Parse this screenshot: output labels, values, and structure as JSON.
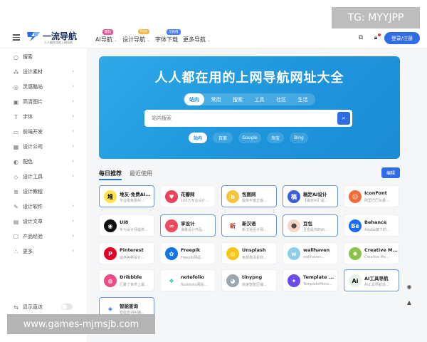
{
  "watermark_top": "TG: MYYJPP",
  "watermark_bottom": "www.games-mjmsjb.com",
  "logo": {
    "title": "一流导航",
    "subtitle": "人人都在用的上网导航"
  },
  "nav": [
    {
      "label": "AI导航",
      "badge": "最热",
      "badge_color": "#e85a9b"
    },
    {
      "label": "设计导航",
      "badge": "New",
      "badge_color": "#f2b84b"
    },
    {
      "label": "字体下载",
      "badge": "可商用",
      "badge_color": "#4a7ff0"
    },
    {
      "label": "更多导航",
      "badge": "",
      "badge_color": ""
    }
  ],
  "login_label": "登录/注册",
  "sidebar": {
    "items": [
      {
        "label": "搜索",
        "icon": "○",
        "arrow": false
      },
      {
        "label": "设计素材",
        "icon": "⁂",
        "arrow": true
      },
      {
        "label": "灵感酷站",
        "icon": "◎",
        "arrow": true
      },
      {
        "label": "高清图片",
        "icon": "▣",
        "arrow": true
      },
      {
        "label": "字体",
        "icon": "T",
        "arrow": true
      },
      {
        "label": "前端开发",
        "icon": "▭",
        "arrow": true
      },
      {
        "label": "设计公司",
        "icon": "▦",
        "arrow": true
      },
      {
        "label": "配色",
        "icon": "◐",
        "arrow": true
      },
      {
        "label": "设计工具",
        "icon": "◇",
        "arrow": true
      },
      {
        "label": "设计教程",
        "icon": "≣",
        "arrow": false
      },
      {
        "label": "设计软件",
        "icon": "✎",
        "arrow": true
      },
      {
        "label": "设计文章",
        "icon": "▤",
        "arrow": true
      },
      {
        "label": "产品经验",
        "icon": "☐",
        "arrow": true
      },
      {
        "label": "更多",
        "icon": "∴",
        "arrow": true
      }
    ],
    "bottom_label": "显示直达"
  },
  "hero": {
    "title": "人人都在用的上网导航网址大全",
    "tabs": [
      "站内",
      "常用",
      "搜索",
      "工具",
      "社区",
      "生活"
    ],
    "active_tab": 0,
    "search_placeholder": "站内搜索",
    "engines": [
      "站内",
      "百度",
      "Google",
      "淘宝",
      "Bing"
    ],
    "active_engine": 0
  },
  "section": {
    "tabs": [
      "每日推荐",
      "最近使用"
    ],
    "edit_label": "编辑"
  },
  "cards": [
    {
      "name": "堆友-免费AI...",
      "desc": "专业级免费AI...",
      "icon": "堆",
      "icon_bg": "#ffe14d",
      "icon_color": "#111",
      "highlight": true
    },
    {
      "name": "花瓣网",
      "desc": "100万专业设计...",
      "icon": "♥",
      "icon_bg": "#e8455b",
      "icon_color": "#fff",
      "highlight": false
    },
    {
      "name": "包图网",
      "desc": "提供丰富正版...",
      "icon": "b",
      "icon_bg": "#f6c33c",
      "icon_color": "#fff",
      "highlight": true
    },
    {
      "name": "稿定AI设计",
      "desc": "【稿定AI】是...",
      "icon": "稿",
      "icon_bg": "#3b5bdb",
      "icon_color": "#fff",
      "highlight": true
    },
    {
      "name": "IconFont",
      "desc": "阿里巴巴矢量...",
      "icon": "☺",
      "icon_bg": "#f26b3a",
      "icon_color": "#fff",
      "highlight": false
    },
    {
      "name": "UI8",
      "desc": "专为设计师提供...",
      "icon": "◉",
      "icon_bg": "#111",
      "icon_color": "#fff",
      "highlight": false
    },
    {
      "name": "享设计",
      "desc": "海量设计作品...",
      "icon": "∞",
      "icon_bg": "#ee4a5f",
      "icon_color": "#fff",
      "highlight": true
    },
    {
      "name": "新汉语",
      "desc": "新汉语设计网...",
      "icon": "新",
      "icon_bg": "#fff",
      "icon_color": "#c0392b",
      "highlight": true
    },
    {
      "name": "豆包",
      "desc": "豆包是你的AI...",
      "icon": "☻",
      "icon_bg": "#f3d7c9",
      "icon_color": "#333",
      "highlight": true
    },
    {
      "name": "Behance",
      "desc": "Adobe旗下的...",
      "icon": "Bē",
      "icon_bg": "#1769ff",
      "icon_color": "#fff",
      "highlight": false
    },
    {
      "name": "Pinterest",
      "desc": "提供各种设计...",
      "icon": "P",
      "icon_bg": "#e60023",
      "icon_color": "#fff",
      "highlight": false
    },
    {
      "name": "Freepik",
      "desc": "Freepik网站...",
      "icon": "✿",
      "icon_bg": "#1273eb",
      "icon_color": "#fff",
      "highlight": false
    },
    {
      "name": "Unsplash",
      "desc": "免费高清素材...",
      "icon": "◎",
      "icon_bg": "#f5c518",
      "icon_color": "#fff",
      "highlight": false
    },
    {
      "name": "wallhaven",
      "desc": "wallhaven...",
      "icon": "w",
      "icon_bg": "#8ecfe8",
      "icon_color": "#fff",
      "highlight": false
    },
    {
      "name": "Creative M...",
      "desc": "Creative Ma...",
      "icon": "✺",
      "icon_bg": "#8bc34a",
      "icon_color": "#fff",
      "highlight": false
    },
    {
      "name": "Dribbble",
      "desc": "汇聚了世界上最...",
      "icon": "◍",
      "icon_bg": "#ea4c89",
      "icon_color": "#fff",
      "highlight": false
    },
    {
      "name": "notefolio",
      "desc": "Notefolio网站...",
      "icon": "❖",
      "icon_bg": "#fff",
      "icon_color": "#1bc3a7",
      "highlight": false
    },
    {
      "name": "tinypng",
      "desc": "快速智能压缩...",
      "icon": "◕",
      "icon_bg": "#9aa7b0",
      "icon_color": "#fff",
      "highlight": false
    },
    {
      "name": "Template ...",
      "desc": "TemplateMons...",
      "icon": "✦",
      "icon_bg": "#6c4ce8",
      "icon_color": "#fff",
      "highlight": false
    },
    {
      "name": "AI工具导航",
      "desc": "AI工具导航站...",
      "icon": "Ai",
      "icon_bg": "#e8f3ea",
      "icon_color": "#111",
      "highlight": true
    },
    {
      "name": "智能查询",
      "desc": "智能查询AI辅...",
      "icon": "◈",
      "icon_bg": "#fff",
      "icon_color": "#2e6de6",
      "highlight": true
    }
  ]
}
